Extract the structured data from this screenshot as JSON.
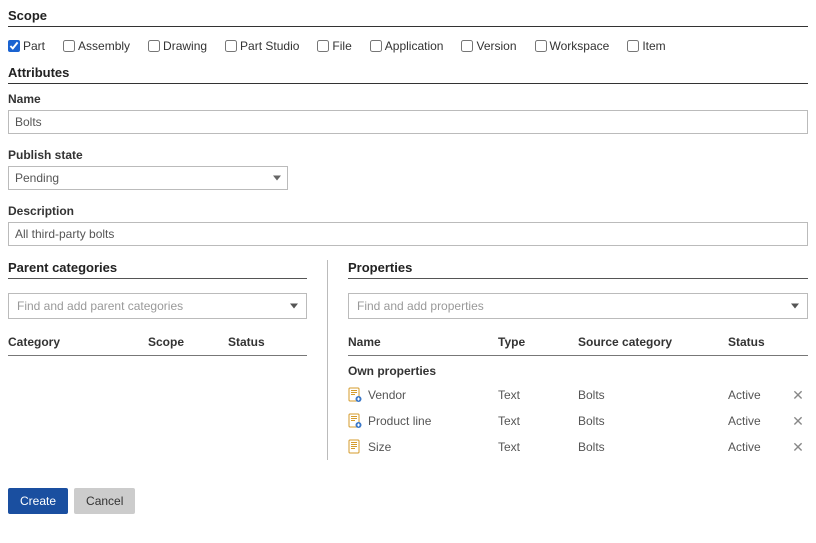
{
  "scope": {
    "title": "Scope",
    "options": [
      {
        "label": "Part",
        "checked": true
      },
      {
        "label": "Assembly",
        "checked": false
      },
      {
        "label": "Drawing",
        "checked": false
      },
      {
        "label": "Part Studio",
        "checked": false
      },
      {
        "label": "File",
        "checked": false
      },
      {
        "label": "Application",
        "checked": false
      },
      {
        "label": "Version",
        "checked": false
      },
      {
        "label": "Workspace",
        "checked": false
      },
      {
        "label": "Item",
        "checked": false
      }
    ]
  },
  "attributes": {
    "title": "Attributes",
    "name_label": "Name",
    "name_value": "Bolts",
    "publish_label": "Publish state",
    "publish_value": "Pending",
    "desc_label": "Description",
    "desc_value": "All third-party bolts"
  },
  "parent": {
    "title": "Parent categories",
    "placeholder": "Find and add parent categories",
    "headers": {
      "category": "Category",
      "scope": "Scope",
      "status": "Status"
    }
  },
  "properties": {
    "title": "Properties",
    "placeholder": "Find and add properties",
    "headers": {
      "name": "Name",
      "type": "Type",
      "source": "Source category",
      "status": "Status"
    },
    "own_label": "Own properties",
    "rows": [
      {
        "icon": "ref",
        "name": "Vendor",
        "type": "Text",
        "source": "Bolts",
        "status": "Active"
      },
      {
        "icon": "ref",
        "name": "Product line",
        "type": "Text",
        "source": "Bolts",
        "status": "Active"
      },
      {
        "icon": "std",
        "name": "Size",
        "type": "Text",
        "source": "Bolts",
        "status": "Active"
      }
    ]
  },
  "footer": {
    "create": "Create",
    "cancel": "Cancel"
  }
}
